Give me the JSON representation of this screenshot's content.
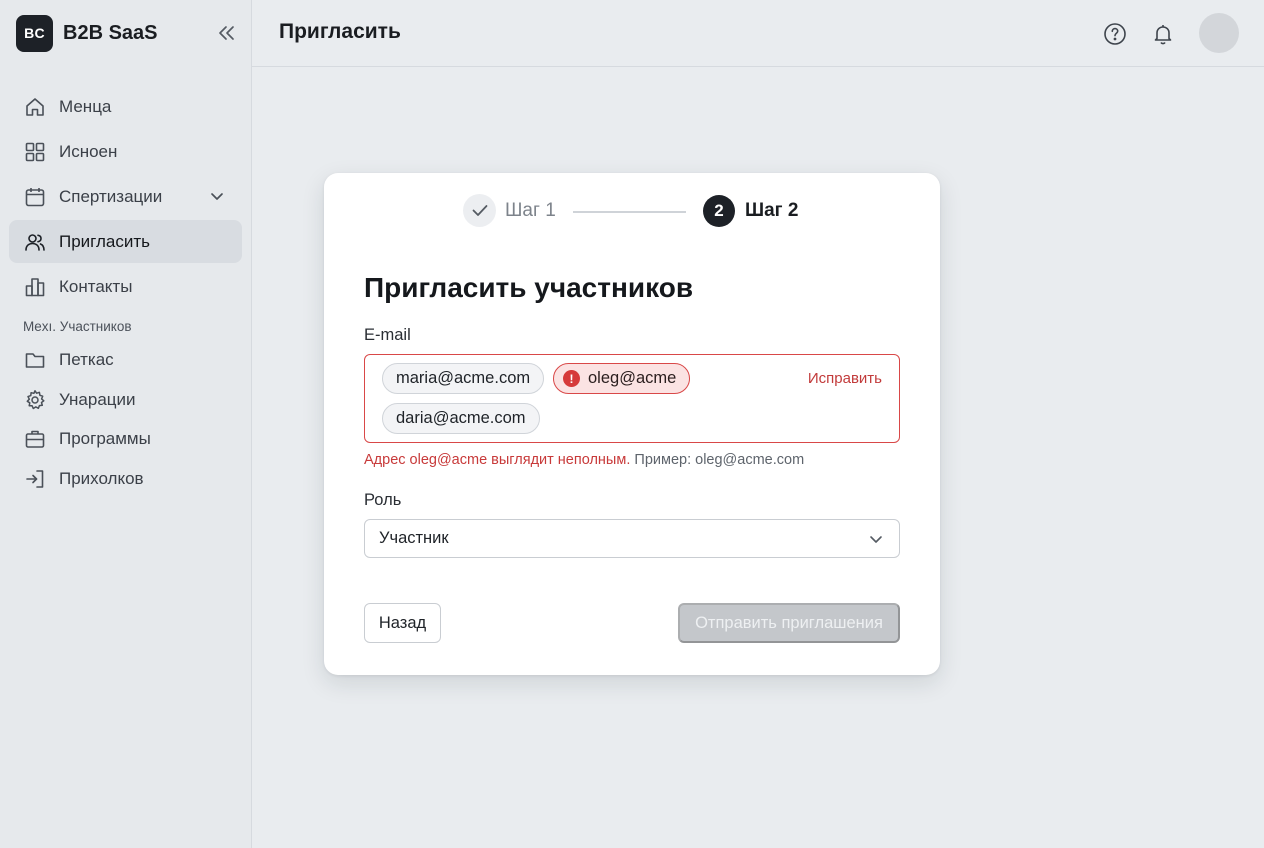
{
  "app": {
    "logo_text": "BC",
    "name": "B2B SaaS"
  },
  "sidebar": {
    "items": [
      {
        "label": "Менца",
        "icon": "home-icon",
        "active": false
      },
      {
        "label": "Исноен",
        "icon": "grid-icon",
        "active": false
      },
      {
        "label": "Спертизации",
        "icon": "calendar-icon",
        "active": false,
        "has_chevron": true
      },
      {
        "label": "Пригласить",
        "icon": "users-icon",
        "active": true
      },
      {
        "label": "Контакты",
        "icon": "bar-chart-icon",
        "active": false
      }
    ],
    "section_label": "Mexı. Участников",
    "section_items": [
      {
        "label": "Петкас",
        "icon": "folder-icon"
      },
      {
        "label": "Унарации",
        "icon": "gear-icon"
      },
      {
        "label": "Программы",
        "icon": "briefcase-icon"
      },
      {
        "label": "Прихолков",
        "icon": "sign-in-icon"
      }
    ]
  },
  "header": {
    "title": "Пригласить"
  },
  "stepper": {
    "step1_label": "Шаг 1",
    "step2_number": "2",
    "step2_label": "Шаг 2"
  },
  "form": {
    "title": "Пригласить участников",
    "email_label": "E-mail",
    "chips": [
      {
        "text": "maria@acme.com",
        "error": false
      },
      {
        "text": "oleg@acme",
        "error": true
      },
      {
        "text": "daria@acme.com",
        "error": false
      }
    ],
    "error_icon": "!",
    "fix_label": "Исправить",
    "error_message": "Адрес oleg@acme выглядит неполным.",
    "error_hint": "Пример: oleg@acme.com",
    "role_label": "Роль",
    "role_value": "Участник"
  },
  "actions": {
    "back_label": "Назад",
    "send_label": "Отправить приглашения",
    "send_disabled": true
  },
  "colors": {
    "accent_dark": "#1d2127",
    "error": "#d94848",
    "disabled": "#c4c7cb"
  }
}
